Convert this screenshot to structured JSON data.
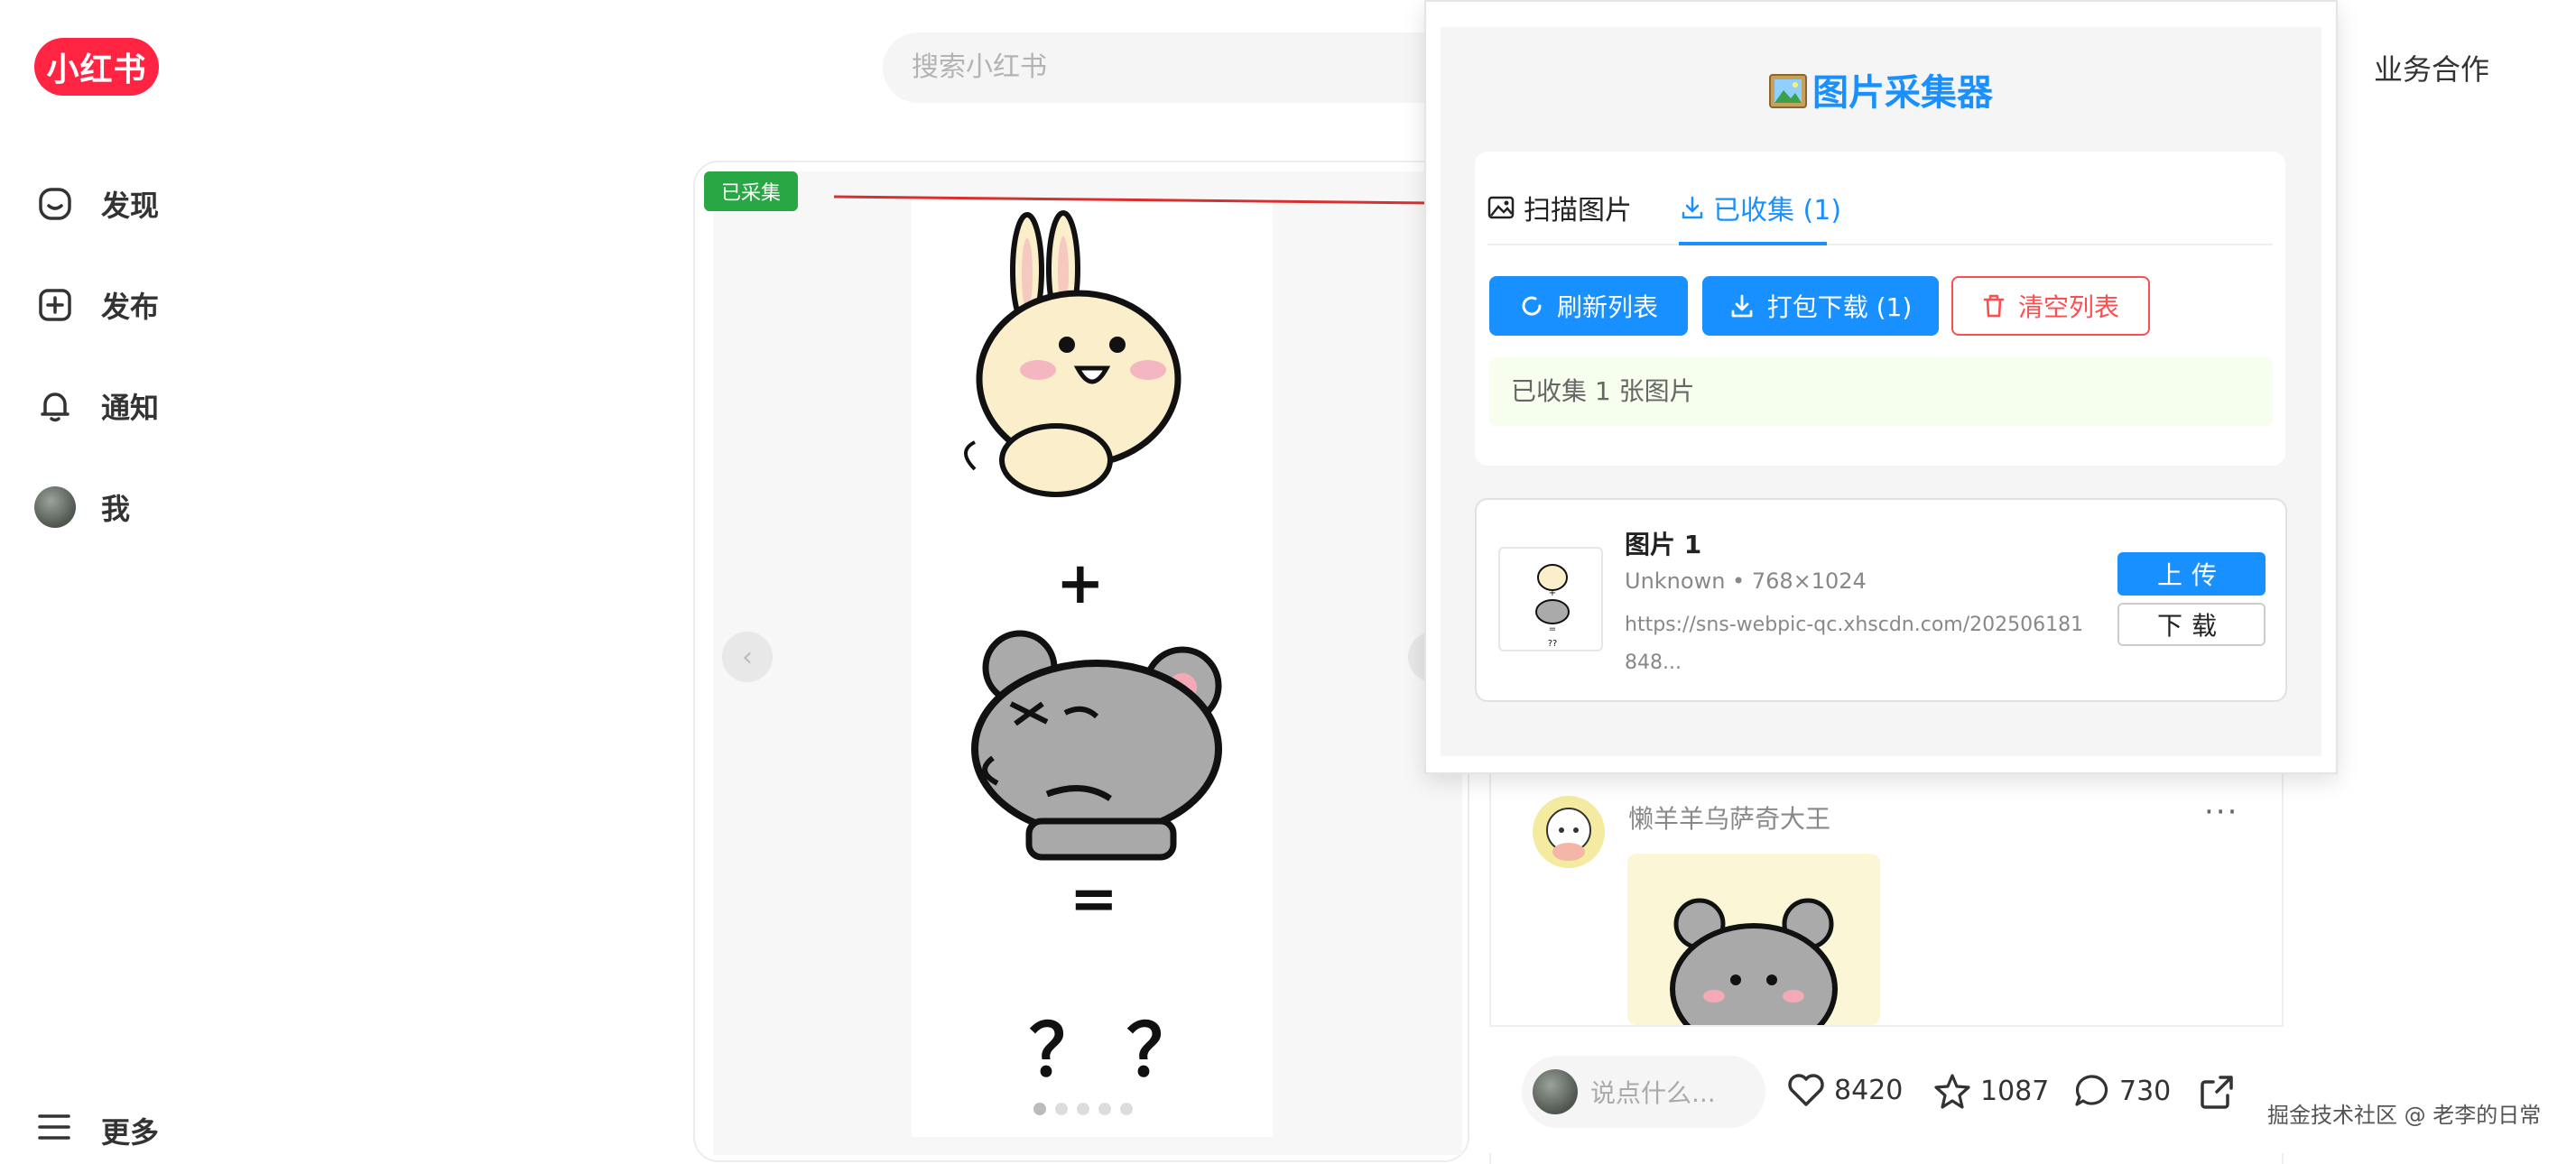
{
  "header": {
    "logo_text": "小红书",
    "search_placeholder": "搜索小红书",
    "business_link": "业务合作"
  },
  "sidebar": {
    "items": [
      {
        "label": "发现",
        "icon": "discover-icon"
      },
      {
        "label": "发布",
        "icon": "publish-plus-icon"
      },
      {
        "label": "通知",
        "icon": "bell-icon"
      },
      {
        "label": "我",
        "icon": "avatar"
      }
    ],
    "more_label": "更多"
  },
  "note": {
    "collected_badge": "已采集",
    "plus_sign": "+",
    "equals_sign": "=",
    "question": "？？",
    "prev_arrow": "‹",
    "next_arrow": "›"
  },
  "comment": {
    "author": "懒羊羊乌萨奇大王",
    "more": "···",
    "input_placeholder": "说点什么...",
    "likes": "8420",
    "collects": "1087",
    "comments": "730"
  },
  "popup": {
    "title": "图片采集器",
    "tabs": [
      {
        "label": "扫描图片",
        "active": false
      },
      {
        "label": "已收集 (1)",
        "active": true
      }
    ],
    "buttons": {
      "refresh": "刷新列表",
      "pack": "打包下载 (1)",
      "clear": "清空列表"
    },
    "info": "已收集 1 张图片",
    "items": [
      {
        "title": "图片 1",
        "meta": "Unknown • 768×1024",
        "url": "https://sns-webpic-qc.xhscdn.com/202506181848...",
        "upload": "上传",
        "download": "下载"
      }
    ]
  },
  "watermark": "掘金技术社区 @ 老李的日常",
  "colors": {
    "brand": "#ff2442",
    "accent": "#1890ff",
    "danger": "#ff4d4f",
    "success": "#29a745"
  }
}
